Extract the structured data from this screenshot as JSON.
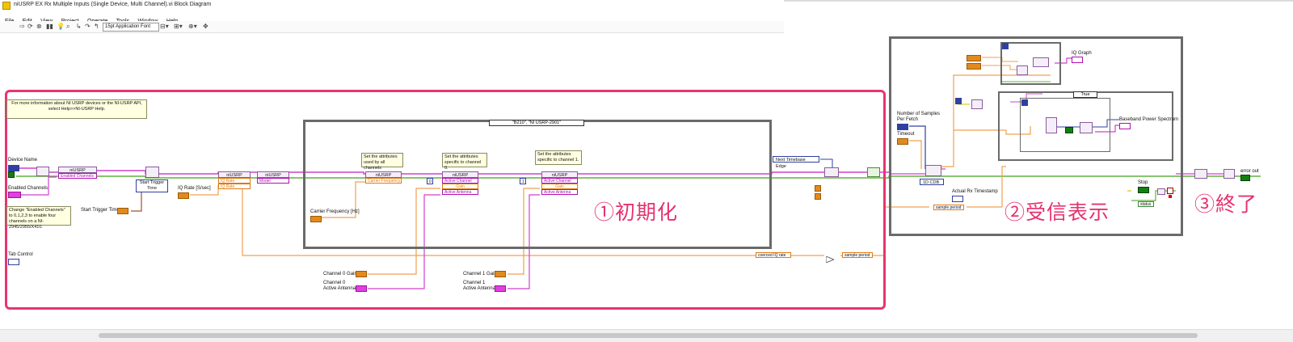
{
  "window": {
    "title": "niUSRP EX Rx Multiple Inputs (Single Device, Multi Channel).vi Block Diagram"
  },
  "menu": [
    "File",
    "Edit",
    "View",
    "Project",
    "Operate",
    "Tools",
    "Window",
    "Help"
  ],
  "toolbar": {
    "font": "15pt Application Font"
  },
  "notes": {
    "help_line1": "For more information about NI USRP devices or the NI-USRP API,",
    "help_line2": "select Help>>NI-USRP Help.",
    "channels_note": "Change \"Enabled Channels\" to 0,1,2,3 to enable four channels on a NI-2945/2955/X410.",
    "attr_all": "Set the attributes used by all channels",
    "attr_ch0": "Set the attributes specific to channel 0.",
    "attr_ch1": "Set the attributes specific to channel 1."
  },
  "labels": {
    "device_name": "Device Name",
    "enabled_channels": "Enabled Channels",
    "start_trigger_time": "Start Trigger Time",
    "iq_rate": "IQ Rate [S/sec]",
    "tab_control": "Tab Control",
    "carrier_frequency": "Carrier Frequency [Hz]",
    "ch0_gain": "Channel 0 Gain",
    "ch0_antenna_l1": "Channel 0",
    "ch0_antenna_l2": "Active Antenna",
    "ch1_gain": "Channel 1 Gain",
    "ch1_antenna_l1": "Channel 1",
    "ch1_antenna_l2": "Active Antenna",
    "coerced_iq_rate": "coerced IQ rate",
    "sample_period": "sample period",
    "num_samples_l1": "Number of Samples",
    "num_samples_l2": "Per Fetch",
    "timeout": "Timeout",
    "actual_rx_ts": "Actual Rx Timestamp",
    "iq_graph": "IQ Graph",
    "baseband_ps": "Baseband Power Spectrum",
    "stop": "Stop",
    "status": "status",
    "error_out": "error out"
  },
  "nodes": {
    "niusrp": "niUSRP",
    "enabled_channels_pin": "Enabled Channels",
    "start_trigger_time_node": "Start Trigger Time",
    "iq_rate_pin": "IQ Rate",
    "iq_rate_pin2": "IQ Rate",
    "model_pin": "Model",
    "carrier_freq_pin": "Carrier Frequency",
    "active_channel": "Active Channel",
    "gain": "Gain",
    "active_antenna": "Active Antenna",
    "next_timebase": "Next Timebase Edge",
    "case_selector": "\"B210\", \"NI USRP-2901\"",
    "true_selector": "True",
    "cdb": "1D CDB",
    "zero": "0",
    "one": "1"
  },
  "sections": {
    "init": "①初期化",
    "rx": "②受信表示",
    "end": "③終了"
  },
  "colors": {
    "highlight": "#e8356f",
    "wire_pink": "#d040d0",
    "wire_orange": "#f0a050",
    "wire_green": "#60b040",
    "wire_yellow": "#d8c000",
    "frame": "#6a6a6a"
  },
  "chart_data": {
    "type": "diagram",
    "title": "niUSRP EX Rx Multiple Inputs (Single Device, Multi Channel).vi Block Diagram",
    "sections": [
      "①初期化",
      "②受信表示",
      "③終了"
    ]
  }
}
